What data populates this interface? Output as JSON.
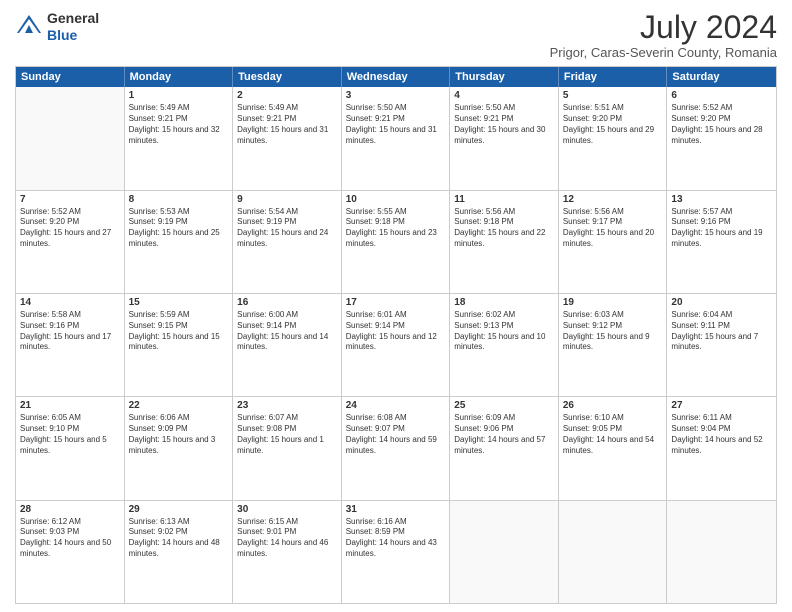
{
  "header": {
    "logo_line1": "General",
    "logo_line2": "Blue",
    "month_title": "July 2024",
    "location": "Prigor, Caras-Severin County, Romania"
  },
  "calendar": {
    "days_of_week": [
      "Sunday",
      "Monday",
      "Tuesday",
      "Wednesday",
      "Thursday",
      "Friday",
      "Saturday"
    ],
    "rows": [
      [
        {
          "day": "",
          "empty": true
        },
        {
          "day": "1",
          "sunrise": "5:49 AM",
          "sunset": "9:21 PM",
          "daylight": "15 hours and 32 minutes."
        },
        {
          "day": "2",
          "sunrise": "5:49 AM",
          "sunset": "9:21 PM",
          "daylight": "15 hours and 31 minutes."
        },
        {
          "day": "3",
          "sunrise": "5:50 AM",
          "sunset": "9:21 PM",
          "daylight": "15 hours and 31 minutes."
        },
        {
          "day": "4",
          "sunrise": "5:50 AM",
          "sunset": "9:21 PM",
          "daylight": "15 hours and 30 minutes."
        },
        {
          "day": "5",
          "sunrise": "5:51 AM",
          "sunset": "9:20 PM",
          "daylight": "15 hours and 29 minutes."
        },
        {
          "day": "6",
          "sunrise": "5:52 AM",
          "sunset": "9:20 PM",
          "daylight": "15 hours and 28 minutes."
        }
      ],
      [
        {
          "day": "7",
          "sunrise": "5:52 AM",
          "sunset": "9:20 PM",
          "daylight": "15 hours and 27 minutes."
        },
        {
          "day": "8",
          "sunrise": "5:53 AM",
          "sunset": "9:19 PM",
          "daylight": "15 hours and 25 minutes."
        },
        {
          "day": "9",
          "sunrise": "5:54 AM",
          "sunset": "9:19 PM",
          "daylight": "15 hours and 24 minutes."
        },
        {
          "day": "10",
          "sunrise": "5:55 AM",
          "sunset": "9:18 PM",
          "daylight": "15 hours and 23 minutes."
        },
        {
          "day": "11",
          "sunrise": "5:56 AM",
          "sunset": "9:18 PM",
          "daylight": "15 hours and 22 minutes."
        },
        {
          "day": "12",
          "sunrise": "5:56 AM",
          "sunset": "9:17 PM",
          "daylight": "15 hours and 20 minutes."
        },
        {
          "day": "13",
          "sunrise": "5:57 AM",
          "sunset": "9:16 PM",
          "daylight": "15 hours and 19 minutes."
        }
      ],
      [
        {
          "day": "14",
          "sunrise": "5:58 AM",
          "sunset": "9:16 PM",
          "daylight": "15 hours and 17 minutes."
        },
        {
          "day": "15",
          "sunrise": "5:59 AM",
          "sunset": "9:15 PM",
          "daylight": "15 hours and 15 minutes."
        },
        {
          "day": "16",
          "sunrise": "6:00 AM",
          "sunset": "9:14 PM",
          "daylight": "15 hours and 14 minutes."
        },
        {
          "day": "17",
          "sunrise": "6:01 AM",
          "sunset": "9:14 PM",
          "daylight": "15 hours and 12 minutes."
        },
        {
          "day": "18",
          "sunrise": "6:02 AM",
          "sunset": "9:13 PM",
          "daylight": "15 hours and 10 minutes."
        },
        {
          "day": "19",
          "sunrise": "6:03 AM",
          "sunset": "9:12 PM",
          "daylight": "15 hours and 9 minutes."
        },
        {
          "day": "20",
          "sunrise": "6:04 AM",
          "sunset": "9:11 PM",
          "daylight": "15 hours and 7 minutes."
        }
      ],
      [
        {
          "day": "21",
          "sunrise": "6:05 AM",
          "sunset": "9:10 PM",
          "daylight": "15 hours and 5 minutes."
        },
        {
          "day": "22",
          "sunrise": "6:06 AM",
          "sunset": "9:09 PM",
          "daylight": "15 hours and 3 minutes."
        },
        {
          "day": "23",
          "sunrise": "6:07 AM",
          "sunset": "9:08 PM",
          "daylight": "15 hours and 1 minute."
        },
        {
          "day": "24",
          "sunrise": "6:08 AM",
          "sunset": "9:07 PM",
          "daylight": "14 hours and 59 minutes."
        },
        {
          "day": "25",
          "sunrise": "6:09 AM",
          "sunset": "9:06 PM",
          "daylight": "14 hours and 57 minutes."
        },
        {
          "day": "26",
          "sunrise": "6:10 AM",
          "sunset": "9:05 PM",
          "daylight": "14 hours and 54 minutes."
        },
        {
          "day": "27",
          "sunrise": "6:11 AM",
          "sunset": "9:04 PM",
          "daylight": "14 hours and 52 minutes."
        }
      ],
      [
        {
          "day": "28",
          "sunrise": "6:12 AM",
          "sunset": "9:03 PM",
          "daylight": "14 hours and 50 minutes."
        },
        {
          "day": "29",
          "sunrise": "6:13 AM",
          "sunset": "9:02 PM",
          "daylight": "14 hours and 48 minutes."
        },
        {
          "day": "30",
          "sunrise": "6:15 AM",
          "sunset": "9:01 PM",
          "daylight": "14 hours and 46 minutes."
        },
        {
          "day": "31",
          "sunrise": "6:16 AM",
          "sunset": "8:59 PM",
          "daylight": "14 hours and 43 minutes."
        },
        {
          "day": "",
          "empty": true
        },
        {
          "day": "",
          "empty": true
        },
        {
          "day": "",
          "empty": true
        }
      ]
    ]
  }
}
